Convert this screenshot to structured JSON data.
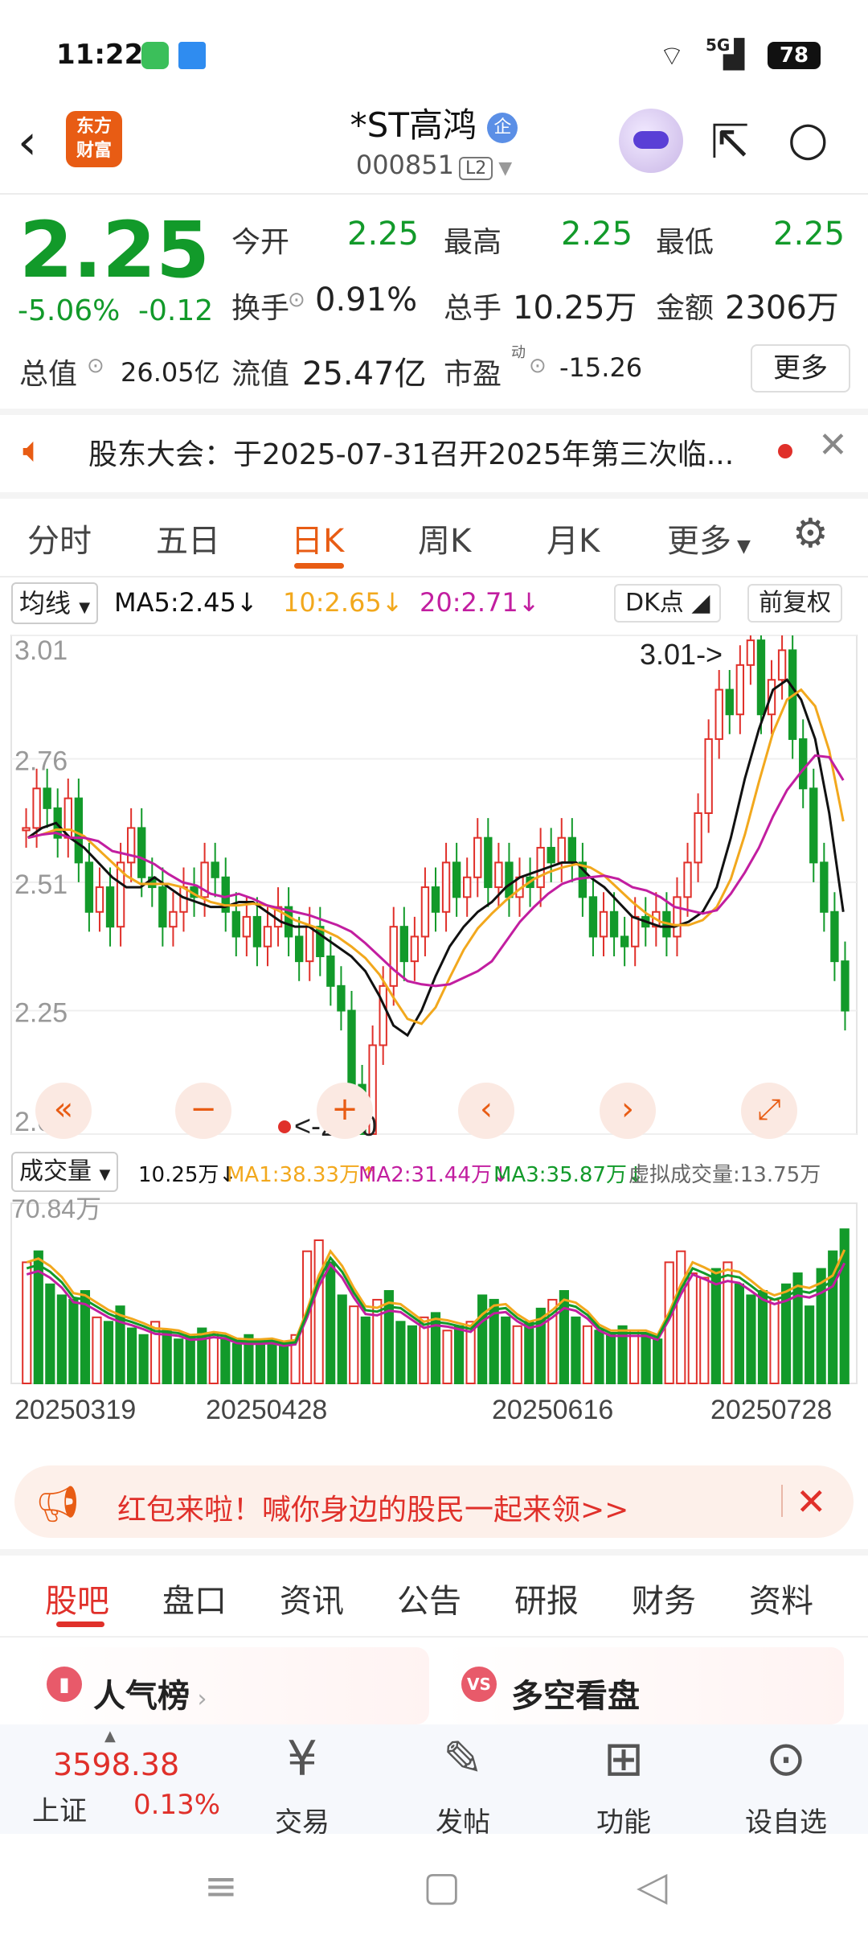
{
  "status_bar": {
    "time": "11:22",
    "network": "5G",
    "battery": "78"
  },
  "header": {
    "logo_line1": "东方",
    "logo_line2": "财富",
    "stock_name": "*ST高鸿",
    "name_badge": "企",
    "stock_code": "000851",
    "level": "L2"
  },
  "quote": {
    "price": "2.25",
    "change_pct": "-5.06%",
    "change": "-0.12",
    "open_label": "今开",
    "open": "2.25",
    "high_label": "最高",
    "high": "2.25",
    "low_label": "最低",
    "low": "2.25",
    "turnover_label": "换手",
    "turnover": "0.91%",
    "volume_label": "总手",
    "volume": "10.25万",
    "amount_label": "金额",
    "amount": "2306万",
    "mktcap_label": "总值",
    "mktcap": "26.05亿",
    "float_label": "流值",
    "float_cap": "25.47亿",
    "pe_label": "市盈",
    "pe_sup": "动",
    "pe": "-15.26",
    "more": "更多"
  },
  "notice": {
    "text": "股东大会：于2025-07-31召开2025年第三次临..."
  },
  "chart_tabs": [
    "分时",
    "五日",
    "日K",
    "周K",
    "月K",
    "更多"
  ],
  "indicator_bar": {
    "type": "均线",
    "ma5": "MA5:2.45",
    "ma10": "10:2.65",
    "ma20": "20:2.71",
    "dk": "DK点",
    "adjust": "前复权"
  },
  "volume_bar": {
    "type": "成交量",
    "vol": "10.25万",
    "ma1": "MA1:38.33万",
    "ma2": "MA2:31.44万",
    "ma3": "MA3:35.87万",
    "virtual": "虚拟成交量:13.75万",
    "max_label": "70.84万"
  },
  "chart_data": {
    "type": "candlestick",
    "y_ticks": [
      "3.01",
      "2.76",
      "2.51",
      "2.25",
      "2.00"
    ],
    "ylim": [
      2.0,
      3.01
    ],
    "high_marker": "3.01->",
    "low_marker": "<-2.00",
    "x_labels": [
      "20250319",
      "20250428",
      "20250616",
      "20250728"
    ],
    "closes": [
      2.62,
      2.7,
      2.66,
      2.6,
      2.68,
      2.55,
      2.45,
      2.5,
      2.42,
      2.55,
      2.62,
      2.52,
      2.5,
      2.42,
      2.45,
      2.5,
      2.48,
      2.55,
      2.52,
      2.45,
      2.4,
      2.44,
      2.38,
      2.42,
      2.46,
      2.4,
      2.35,
      2.42,
      2.36,
      2.3,
      2.25,
      2.1,
      2.0,
      2.18,
      2.3,
      2.42,
      2.35,
      2.4,
      2.5,
      2.45,
      2.55,
      2.48,
      2.52,
      2.6,
      2.5,
      2.55,
      2.48,
      2.52,
      2.5,
      2.58,
      2.55,
      2.6,
      2.55,
      2.48,
      2.4,
      2.45,
      2.4,
      2.38,
      2.44,
      2.42,
      2.45,
      2.4,
      2.48,
      2.55,
      2.65,
      2.8,
      2.9,
      2.85,
      2.95,
      3.0,
      2.85,
      2.92,
      2.98,
      2.8,
      2.7,
      2.55,
      2.45,
      2.35,
      2.25
    ],
    "ma5": [
      2.6,
      2.62,
      2.63,
      2.6,
      2.58,
      2.55,
      2.52,
      2.5,
      2.5,
      2.52,
      2.5,
      2.48,
      2.47,
      2.46,
      2.46,
      2.47,
      2.47,
      2.45,
      2.43,
      2.42,
      2.42,
      2.4,
      2.38,
      2.36,
      2.33,
      2.28,
      2.22,
      2.2,
      2.25,
      2.32,
      2.38,
      2.42,
      2.45,
      2.47,
      2.5,
      2.52,
      2.53,
      2.54,
      2.55,
      2.55,
      2.52,
      2.5,
      2.47,
      2.44,
      2.43,
      2.42,
      2.42,
      2.43,
      2.45,
      2.5,
      2.6,
      2.72,
      2.82,
      2.9,
      2.92,
      2.88,
      2.8,
      2.65,
      2.45
    ],
    "vol_scale": 70.84,
    "volumes": [
      55,
      60,
      45,
      40,
      38,
      42,
      30,
      28,
      35,
      25,
      22,
      28,
      24,
      20,
      22,
      25,
      23,
      20,
      18,
      22,
      20,
      19,
      18,
      22,
      60,
      65,
      55,
      40,
      35,
      30,
      38,
      42,
      28,
      26,
      30,
      32,
      24,
      26,
      28,
      40,
      38,
      30,
      26,
      28,
      34,
      38,
      42,
      30,
      26,
      24,
      22,
      26,
      24,
      22,
      20,
      55,
      60,
      50,
      48,
      52,
      55,
      45,
      40,
      42,
      38,
      45,
      50,
      35,
      52,
      60,
      70
    ],
    "vol_colors": [
      "r",
      "g",
      "g",
      "g",
      "g",
      "g",
      "r",
      "g",
      "g",
      "g",
      "g",
      "r",
      "g",
      "g",
      "g",
      "g",
      "r",
      "g",
      "g",
      "g",
      "g",
      "g",
      "g",
      "r",
      "r",
      "r",
      "g",
      "g",
      "r",
      "g",
      "r",
      "g",
      "g",
      "g",
      "r",
      "g",
      "r",
      "g",
      "r",
      "g",
      "g",
      "g",
      "r",
      "g",
      "g",
      "r",
      "g",
      "g",
      "r",
      "g",
      "g",
      "g",
      "r",
      "g",
      "g",
      "r",
      "r",
      "r",
      "r",
      "g",
      "r",
      "g",
      "g",
      "g",
      "r",
      "g",
      "g",
      "g",
      "g",
      "g",
      "g"
    ]
  },
  "chart_controls": {
    "far_left": "«",
    "minus": "−",
    "plus": "+",
    "prev": "‹",
    "next": "›",
    "expand": "⤢"
  },
  "banner": {
    "text": "红包来啦！喊你身边的股民一起来领>>"
  },
  "bottom_tabs": [
    "股吧",
    "盘口",
    "资讯",
    "公告",
    "研报",
    "财务",
    "资料"
  ],
  "cards": [
    {
      "title": "人气榜"
    },
    {
      "title": "多空看盘"
    }
  ],
  "bottom_bar": {
    "index_value": "3598.38",
    "index_name": "上证",
    "index_change": "0.13%",
    "trade": "交易",
    "post": "发帖",
    "function": "功能",
    "watchlist": "设自选"
  },
  "colors": {
    "up": "#e0302a",
    "down": "#129a2a",
    "accent": "#e85c14",
    "ma5": "#111111",
    "ma10": "#f2a81d",
    "ma20": "#c21ea0"
  }
}
